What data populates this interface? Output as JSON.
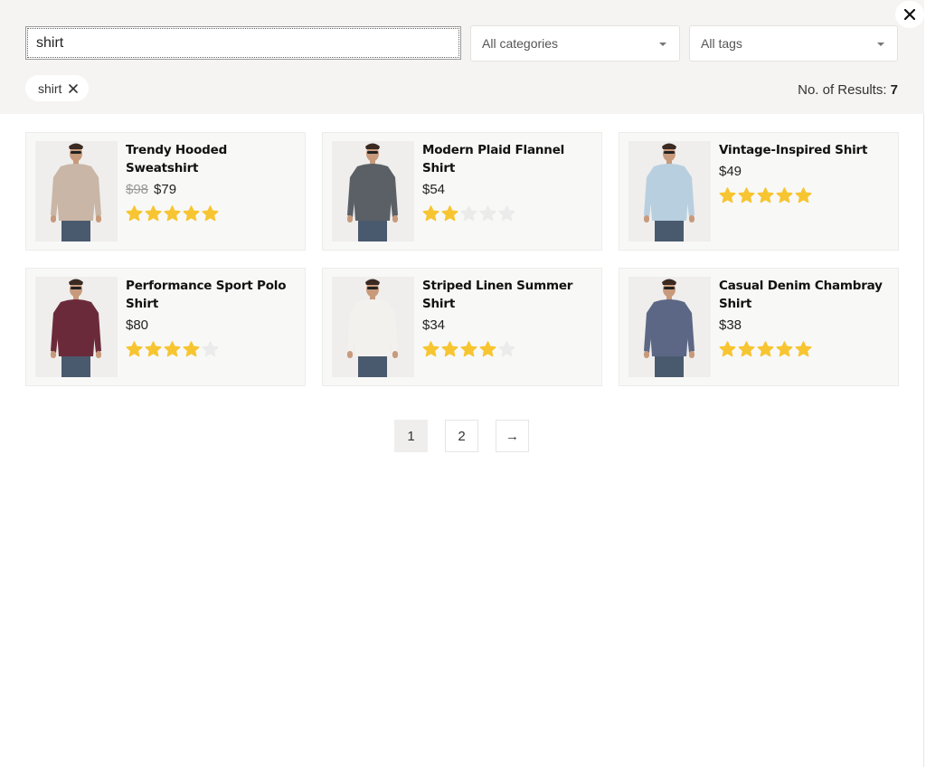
{
  "search": {
    "value": "shirt",
    "placeholder": ""
  },
  "filters": {
    "category_label": "All categories",
    "tags_label": "All tags"
  },
  "active_chip": {
    "label": "shirt"
  },
  "results": {
    "label": "No. of Results:",
    "count": "7"
  },
  "colors": {
    "star_on": "#f7c531",
    "star_off": "#ebebeb",
    "panel_bg": "#f5f4f2"
  },
  "products": [
    {
      "title": "Trendy Hooded Sweatshirt",
      "old_price": "$98",
      "price": "$79",
      "rating": 5,
      "shirt_color": "#c9b6a6"
    },
    {
      "title": "Modern Plaid Flannel Shirt",
      "old_price": "",
      "price": "$54",
      "rating": 2,
      "shirt_color": "#5a6066"
    },
    {
      "title": "Vintage-Inspired Shirt",
      "old_price": "",
      "price": "$49",
      "rating": 5,
      "shirt_color": "#b8cfe0"
    },
    {
      "title": "Performance Sport Polo Shirt",
      "old_price": "",
      "price": "$80",
      "rating": 4,
      "shirt_color": "#6b2a3a"
    },
    {
      "title": "Striped Linen Summer Shirt",
      "old_price": "",
      "price": "$34",
      "rating": 4,
      "shirt_color": "#f3f1ee"
    },
    {
      "title": "Casual Denim Chambray Shirt",
      "old_price": "",
      "price": "$38",
      "rating": 5,
      "shirt_color": "#5c6785"
    }
  ],
  "pagination": {
    "pages": [
      "1",
      "2"
    ],
    "next": "→",
    "current": "1"
  },
  "icons": {
    "close": "close-icon",
    "caret": "chevron-down-icon",
    "remove": "close-icon",
    "star": "star-icon",
    "next": "arrow-right-icon"
  }
}
